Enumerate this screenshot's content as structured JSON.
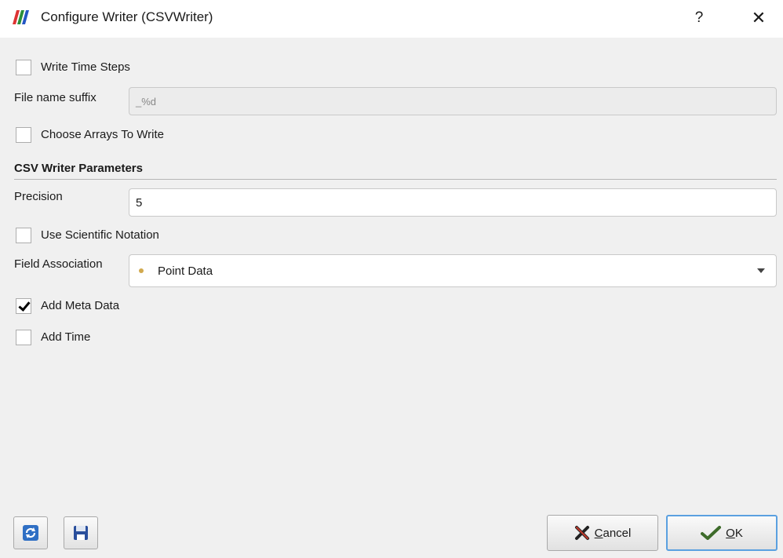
{
  "window": {
    "title": "Configure Writer (CSVWriter)",
    "help_label": "?",
    "close_label": "✕"
  },
  "general": {
    "write_time_steps": {
      "label": "Write Time Steps",
      "checked": false
    },
    "file_name_suffix": {
      "label": "File name suffix",
      "value": "_%d",
      "enabled": false
    },
    "choose_arrays": {
      "label": "Choose Arrays To Write",
      "checked": false
    }
  },
  "csv_section": {
    "title": "CSV Writer Parameters",
    "precision": {
      "label": "Precision",
      "value": "5"
    },
    "use_scientific": {
      "label": "Use Scientific Notation",
      "checked": false
    },
    "field_association": {
      "label": "Field Association",
      "value": "Point Data"
    },
    "add_meta_data": {
      "label": "Add Meta Data",
      "checked": true
    },
    "add_time": {
      "label": "Add Time",
      "checked": false
    }
  },
  "footer": {
    "reload_icon": "refresh-icon",
    "save_icon": "floppy-disk-icon",
    "cancel_mnemonic": "C",
    "cancel_rest": "ancel",
    "ok_mnemonic": "O",
    "ok_rest": "K"
  },
  "colors": {
    "accent": "#5aa0e0",
    "dot": "#d1a94e"
  }
}
